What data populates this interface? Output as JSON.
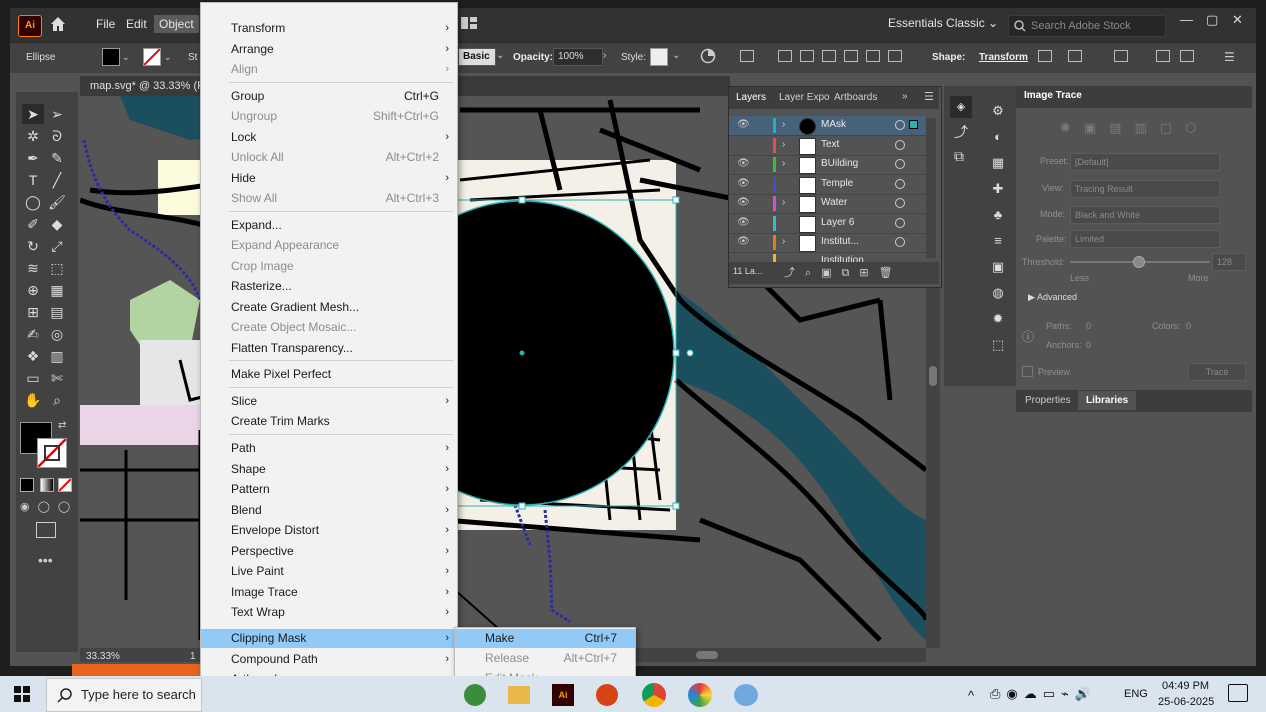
{
  "app": {
    "logo": "Ai",
    "menus": [
      "File",
      "Edit",
      "Object",
      "St"
    ],
    "workspace": "Essentials Classic",
    "search_placeholder": "Search Adobe Stock"
  },
  "control_bar": {
    "selection_label": "Ellipse",
    "stroke_style": "Basic",
    "opacity_label": "Opacity:",
    "opacity_value": "100%",
    "style_label": "Style:",
    "shape_label": "Shape:",
    "transform_label": "Transform"
  },
  "document": {
    "tab_title": "map.svg* @ 33.33% (R",
    "zoom": "33.33%",
    "page": "1"
  },
  "object_menu": {
    "items": [
      {
        "label": "Transform",
        "shortcut": "",
        "submenu": true,
        "enabled": true
      },
      {
        "label": "Arrange",
        "shortcut": "",
        "submenu": true,
        "enabled": true
      },
      {
        "label": "Align",
        "shortcut": "",
        "submenu": true,
        "enabled": false
      },
      {
        "label": "Group",
        "shortcut": "Ctrl+G",
        "submenu": false,
        "enabled": true
      },
      {
        "label": "Ungroup",
        "shortcut": "Shift+Ctrl+G",
        "submenu": false,
        "enabled": false
      },
      {
        "label": "Lock",
        "shortcut": "",
        "submenu": true,
        "enabled": true
      },
      {
        "label": "Unlock All",
        "shortcut": "Alt+Ctrl+2",
        "submenu": false,
        "enabled": false
      },
      {
        "label": "Hide",
        "shortcut": "",
        "submenu": true,
        "enabled": true
      },
      {
        "label": "Show All",
        "shortcut": "Alt+Ctrl+3",
        "submenu": false,
        "enabled": false
      },
      {
        "label": "Expand...",
        "shortcut": "",
        "submenu": false,
        "enabled": true
      },
      {
        "label": "Expand Appearance",
        "shortcut": "",
        "submenu": false,
        "enabled": false
      },
      {
        "label": "Crop Image",
        "shortcut": "",
        "submenu": false,
        "enabled": false
      },
      {
        "label": "Rasterize...",
        "shortcut": "",
        "submenu": false,
        "enabled": true
      },
      {
        "label": "Create Gradient Mesh...",
        "shortcut": "",
        "submenu": false,
        "enabled": true
      },
      {
        "label": "Create Object Mosaic...",
        "shortcut": "",
        "submenu": false,
        "enabled": false
      },
      {
        "label": "Flatten Transparency...",
        "shortcut": "",
        "submenu": false,
        "enabled": true
      },
      {
        "label": "Make Pixel Perfect",
        "shortcut": "",
        "submenu": false,
        "enabled": true
      },
      {
        "label": "Slice",
        "shortcut": "",
        "submenu": true,
        "enabled": true
      },
      {
        "label": "Create Trim Marks",
        "shortcut": "",
        "submenu": false,
        "enabled": true
      },
      {
        "label": "Path",
        "shortcut": "",
        "submenu": true,
        "enabled": true
      },
      {
        "label": "Shape",
        "shortcut": "",
        "submenu": true,
        "enabled": true
      },
      {
        "label": "Pattern",
        "shortcut": "",
        "submenu": true,
        "enabled": true
      },
      {
        "label": "Blend",
        "shortcut": "",
        "submenu": true,
        "enabled": true
      },
      {
        "label": "Envelope Distort",
        "shortcut": "",
        "submenu": true,
        "enabled": true
      },
      {
        "label": "Perspective",
        "shortcut": "",
        "submenu": true,
        "enabled": true
      },
      {
        "label": "Live Paint",
        "shortcut": "",
        "submenu": true,
        "enabled": true
      },
      {
        "label": "Image Trace",
        "shortcut": "",
        "submenu": true,
        "enabled": true
      },
      {
        "label": "Text Wrap",
        "shortcut": "",
        "submenu": true,
        "enabled": true
      },
      {
        "label": "Clipping Mask",
        "shortcut": "",
        "submenu": true,
        "enabled": true,
        "highlighted": true
      },
      {
        "label": "Compound Path",
        "shortcut": "",
        "submenu": true,
        "enabled": true
      },
      {
        "label": "Artboards",
        "shortcut": "",
        "submenu": true,
        "enabled": true
      }
    ]
  },
  "clipping_submenu": {
    "items": [
      {
        "label": "Make",
        "shortcut": "Ctrl+7",
        "enabled": true,
        "highlighted": true
      },
      {
        "label": "Release",
        "shortcut": "Alt+Ctrl+7",
        "enabled": false
      },
      {
        "label": "Edit Mask",
        "shortcut": "",
        "enabled": false
      }
    ]
  },
  "layers_panel": {
    "tabs": [
      "Layers",
      "Layer Expo",
      "Artboards"
    ],
    "footer_count": "11 La...",
    "layers": [
      {
        "name": "MAsk",
        "color": "#27b2b2",
        "selected": true,
        "visible": true,
        "expand": true
      },
      {
        "name": "Text",
        "color": "#e05050",
        "selected": false,
        "visible": false,
        "expand": true
      },
      {
        "name": "BUilding",
        "color": "#38c038",
        "selected": false,
        "visible": true,
        "expand": true
      },
      {
        "name": "Temple",
        "color": "#4a4ad0",
        "selected": false,
        "visible": true,
        "expand": false
      },
      {
        "name": "Water",
        "color": "#d050d0",
        "selected": false,
        "visible": true,
        "expand": true
      },
      {
        "name": "Layer 6",
        "color": "#30c0c0",
        "selected": false,
        "visible": true,
        "expand": false
      },
      {
        "name": "Institut...",
        "color": "#e07b20",
        "selected": false,
        "visible": true,
        "expand": true
      },
      {
        "name": "Institution",
        "color": "#e0c020",
        "selected": false,
        "visible": true,
        "expand": true
      }
    ]
  },
  "image_trace_panel": {
    "title": "Image Trace",
    "preset_label": "Preset:",
    "preset_value": "[Default]",
    "view_label": "View:",
    "view_value": "Tracing Result",
    "mode_label": "Mode:",
    "mode_value": "Black and White",
    "palette_label": "Palette:",
    "palette_value": "Limited",
    "threshold_label": "Threshold:",
    "threshold_value": "128",
    "less": "Less",
    "more": "More",
    "advanced": "Advanced",
    "paths_label": "Paths:",
    "paths_value": "0",
    "colors_label": "Colors:",
    "colors_value": "0",
    "anchors_label": "Anchors:",
    "anchors_value": "0",
    "preview_label": "Preview",
    "trace_button": "Trace"
  },
  "properties_tabs": [
    "Properties",
    "Libraries"
  ],
  "taskbar": {
    "search_placeholder": "Type here to search",
    "language": "ENG",
    "time": "04:49 PM",
    "date": "25-06-2025"
  },
  "colors": {
    "accent": "#91c9f7",
    "water": "#1b4f5e",
    "selection": "#27b2b2"
  }
}
